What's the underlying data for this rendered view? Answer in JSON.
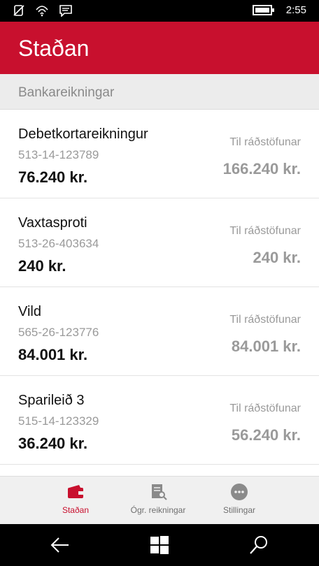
{
  "status": {
    "time": "2:55",
    "icons": [
      "no-sim-icon",
      "wifi-icon",
      "message-icon",
      "battery-icon"
    ]
  },
  "header": {
    "title": "Staðan"
  },
  "section": {
    "title": "Bankareikningar"
  },
  "accounts": [
    {
      "name": "Debetkortareikningur",
      "number": "513-14-123789",
      "balance": "76.240 kr.",
      "available_label": "Til ráðstöfunar",
      "available": "166.240 kr."
    },
    {
      "name": "Vaxtasproti",
      "number": "513-26-403634",
      "balance": "240 kr.",
      "available_label": "Til ráðstöfunar",
      "available": "240 kr."
    },
    {
      "name": "Vild",
      "number": "565-26-123776",
      "balance": "84.001 kr.",
      "available_label": "Til ráðstöfunar",
      "available": "84.001 kr."
    },
    {
      "name": "Sparileið 3",
      "number": "515-14-123329",
      "balance": "36.240 kr.",
      "available_label": "Til ráðstöfunar",
      "available": "56.240 kr."
    }
  ],
  "nav": {
    "items": [
      {
        "label": "Staðan",
        "icon": "wallet-icon"
      },
      {
        "label": "Ógr. reikningar",
        "icon": "bill-search-icon"
      },
      {
        "label": "Stillingar",
        "icon": "more-icon"
      }
    ]
  },
  "colors": {
    "accent": "#c8102e",
    "muted": "#9a9a9a"
  }
}
